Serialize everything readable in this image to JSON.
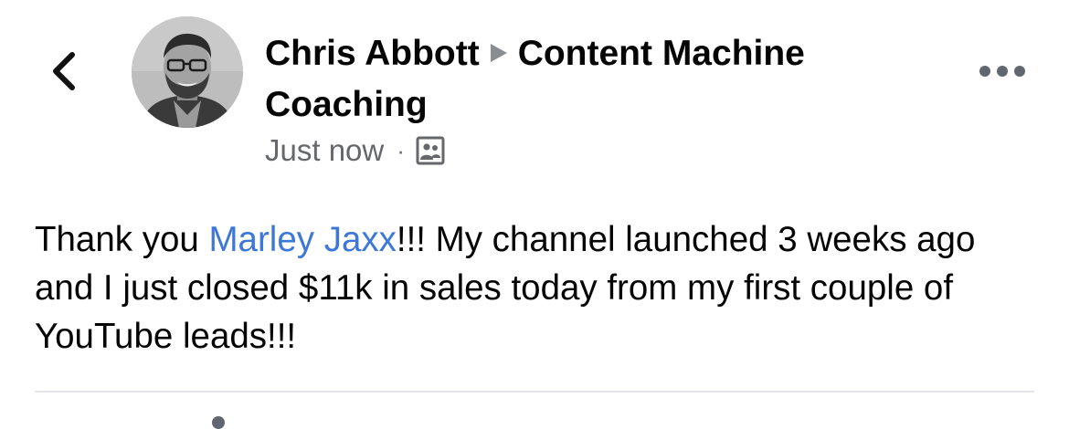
{
  "header": {
    "author_name": "Chris Abbott",
    "group_name": "Content Machine Coaching",
    "timestamp": "Just now",
    "separator": "·",
    "back_icon": "chevron-left-icon",
    "more_icon": "ellipsis-icon",
    "audience_icon": "group-members-icon",
    "arrow_icon": "triangle-right-icon"
  },
  "post": {
    "text_before_mention": "Thank you ",
    "mention": "Marley Jaxx",
    "text_after_mention": "!!! My channel launched 3 weeks ago and I just closed $11k in sales today from my first couple of YouTube leads!!!"
  },
  "colors": {
    "mention": "#3d78d8",
    "secondary_text": "#65676b",
    "primary_text": "#050505",
    "divider": "#e4e6eb"
  }
}
